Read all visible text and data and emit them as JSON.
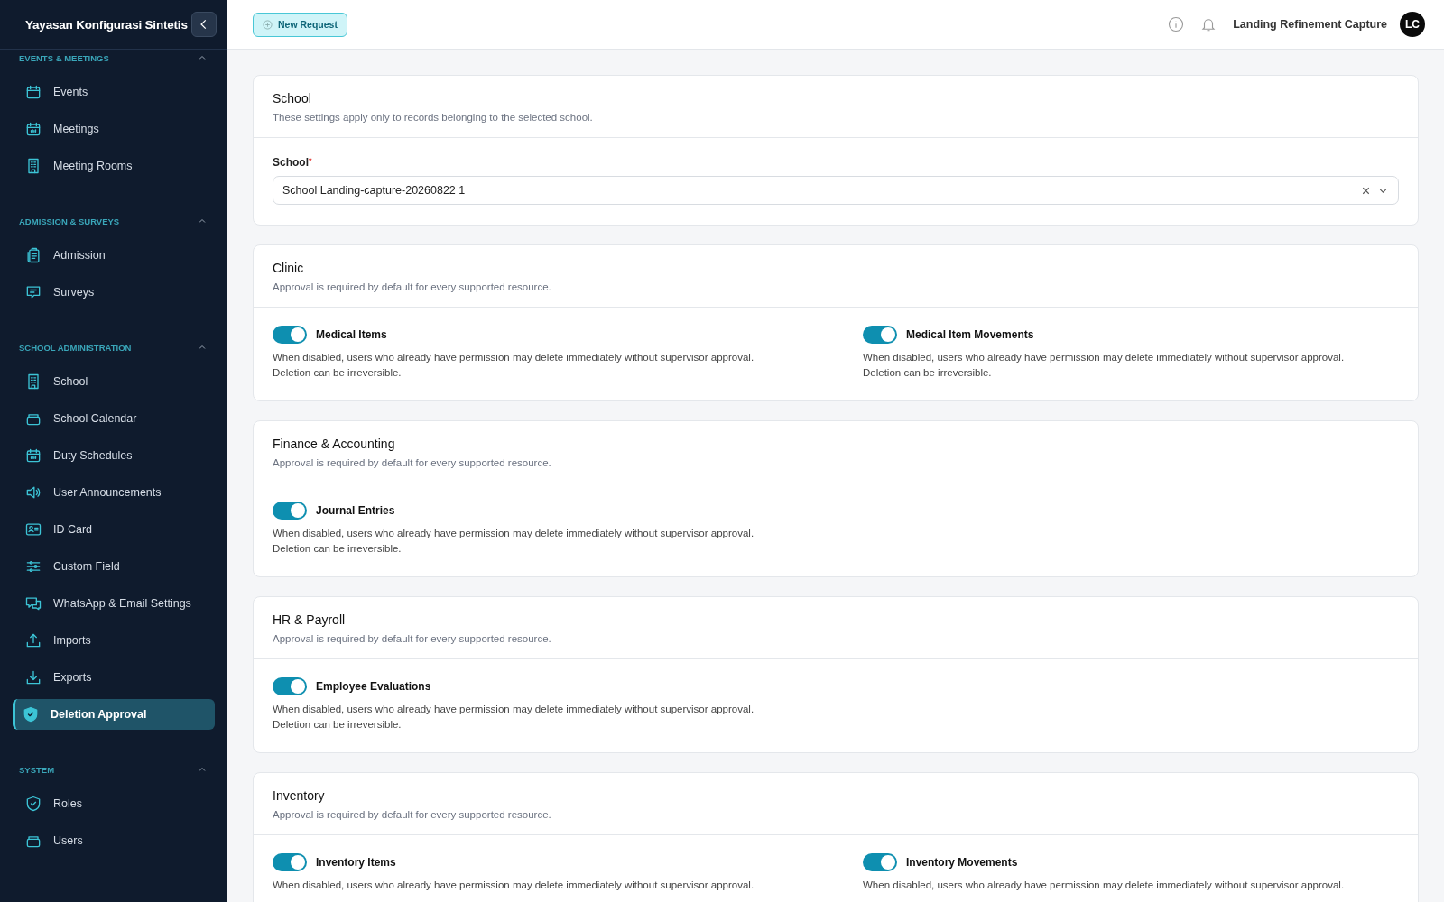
{
  "sidebar": {
    "title": "Yayasan Konfigurasi Sintetis",
    "sections": [
      {
        "label": "EVENTS & MEETINGS",
        "expanded": true,
        "items": [
          {
            "label": "Events",
            "selected": false
          },
          {
            "label": "Meetings",
            "selected": false
          },
          {
            "label": "Meeting Rooms",
            "selected": false
          }
        ]
      },
      {
        "label": "ADMISSION & SURVEYS",
        "expanded": true,
        "items": [
          {
            "label": "Admission",
            "selected": false
          },
          {
            "label": "Surveys",
            "selected": false
          }
        ]
      },
      {
        "label": "SCHOOL ADMINISTRATION",
        "expanded": true,
        "items": [
          {
            "label": "School",
            "selected": false
          },
          {
            "label": "School Calendar",
            "selected": false
          },
          {
            "label": "Duty Schedules",
            "selected": false
          },
          {
            "label": "User Announcements",
            "selected": false
          },
          {
            "label": "ID Card",
            "selected": false
          },
          {
            "label": "Custom Field",
            "selected": false
          },
          {
            "label": "WhatsApp & Email Settings",
            "selected": false
          },
          {
            "label": "Imports",
            "selected": false
          },
          {
            "label": "Exports",
            "selected": false
          },
          {
            "label": "Deletion Approval",
            "selected": true
          }
        ]
      },
      {
        "label": "SYSTEM",
        "expanded": true,
        "items": [
          {
            "label": "Roles",
            "selected": false
          },
          {
            "label": "Users",
            "selected": false
          }
        ]
      }
    ]
  },
  "header": {
    "button": "New Request",
    "user": "Landing Refinement Capture",
    "avatar": "LC"
  },
  "school_card": {
    "title": "School",
    "subtitle": "These settings apply only to records belonging to the selected school.",
    "field_label": "School",
    "required": true,
    "required_mark": "*",
    "value": "School Landing-capture-20260822 1"
  },
  "sections": [
    {
      "title": "Clinic",
      "subtitle": "Approval is required by default for every supported resource.",
      "items": [
        {
          "label": "Medical Items",
          "on": true,
          "description": "When disabled, users who already have permission may delete immediately without supervisor approval. Deletion can be irreversible."
        },
        {
          "label": "Medical Item Movements",
          "on": true,
          "description": "When disabled, users who already have permission may delete immediately without supervisor approval. Deletion can be irreversible."
        }
      ]
    },
    {
      "title": "Finance & Accounting",
      "subtitle": "Approval is required by default for every supported resource.",
      "items": [
        {
          "label": "Journal Entries",
          "on": true,
          "description": "When disabled, users who already have permission may delete immediately without supervisor approval. Deletion can be irreversible."
        }
      ]
    },
    {
      "title": "HR & Payroll",
      "subtitle": "Approval is required by default for every supported resource.",
      "items": [
        {
          "label": "Employee Evaluations",
          "on": true,
          "description": "When disabled, users who already have permission may delete immediately without supervisor approval. Deletion can be irreversible."
        }
      ]
    },
    {
      "title": "Inventory",
      "subtitle": "Approval is required by default for every supported resource.",
      "items": [
        {
          "label": "Inventory Items",
          "on": true,
          "description": "When disabled, users who already have permission may delete immediately without supervisor approval."
        },
        {
          "label": "Inventory Movements",
          "on": true,
          "description": "When disabled, users who already have permission may delete immediately without supervisor approval."
        }
      ]
    }
  ]
}
